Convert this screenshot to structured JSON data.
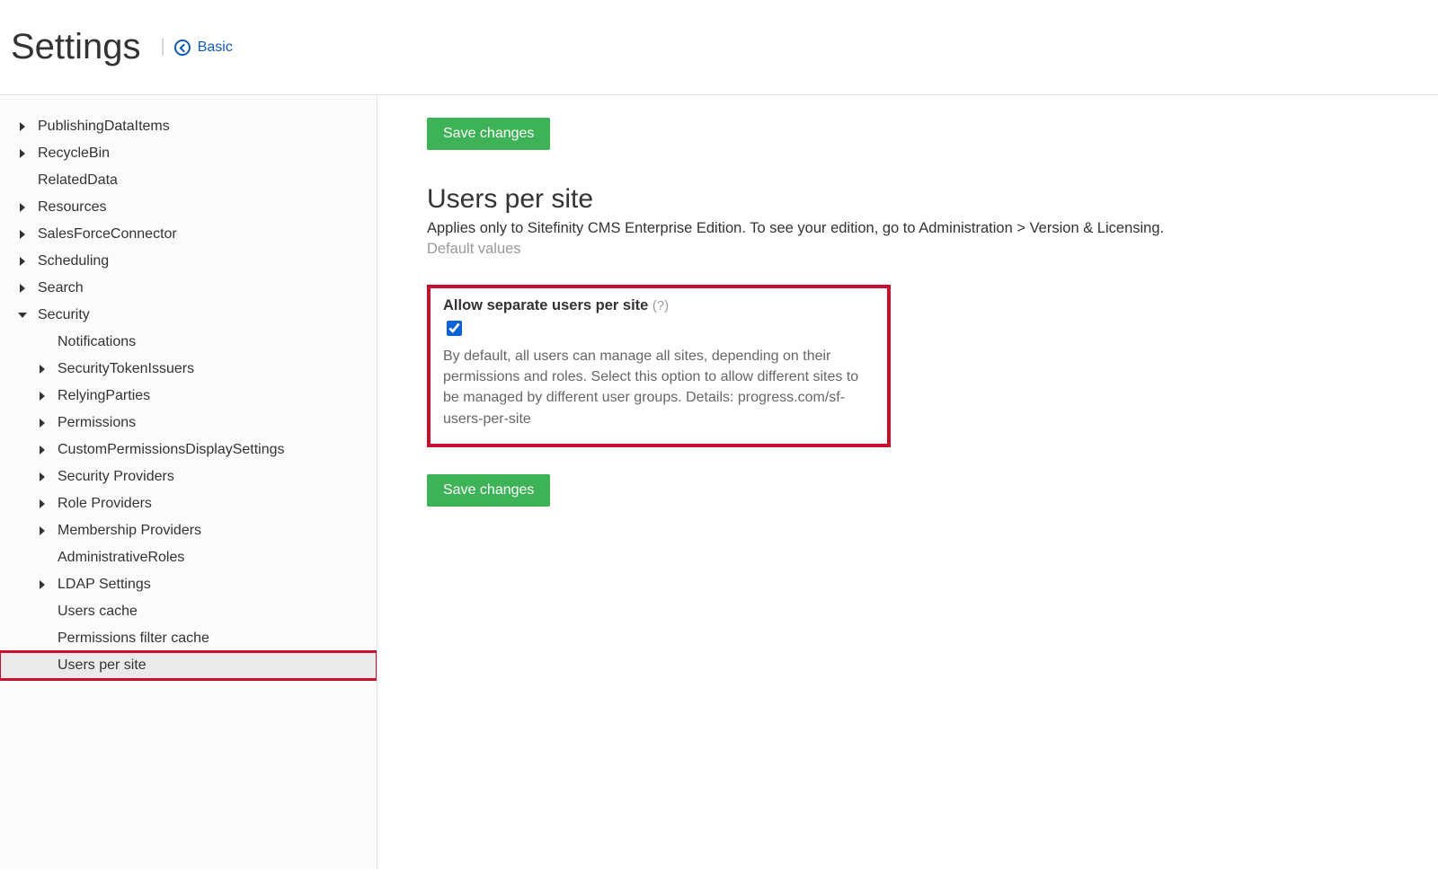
{
  "header": {
    "title": "Settings",
    "basic_link": "Basic"
  },
  "sidebar": {
    "items": [
      {
        "label": "PublishingDataItems",
        "level": 0,
        "caret": "right"
      },
      {
        "label": "RecycleBin",
        "level": 0,
        "caret": "right"
      },
      {
        "label": "RelatedData",
        "level": 0,
        "caret": "none"
      },
      {
        "label": "Resources",
        "level": 0,
        "caret": "right"
      },
      {
        "label": "SalesForceConnector",
        "level": 0,
        "caret": "right"
      },
      {
        "label": "Scheduling",
        "level": 0,
        "caret": "right"
      },
      {
        "label": "Search",
        "level": 0,
        "caret": "right"
      },
      {
        "label": "Security",
        "level": 0,
        "caret": "down"
      },
      {
        "label": "Notifications",
        "level": 1,
        "caret": "none"
      },
      {
        "label": "SecurityTokenIssuers",
        "level": 1,
        "caret": "right"
      },
      {
        "label": "RelyingParties",
        "level": 1,
        "caret": "right"
      },
      {
        "label": "Permissions",
        "level": 1,
        "caret": "right"
      },
      {
        "label": "CustomPermissionsDisplaySettings",
        "level": 1,
        "caret": "right"
      },
      {
        "label": "Security Providers",
        "level": 1,
        "caret": "right"
      },
      {
        "label": "Role Providers",
        "level": 1,
        "caret": "right"
      },
      {
        "label": "Membership Providers",
        "level": 1,
        "caret": "right"
      },
      {
        "label": "AdministrativeRoles",
        "level": 1,
        "caret": "none"
      },
      {
        "label": "LDAP Settings",
        "level": 1,
        "caret": "right"
      },
      {
        "label": "Users cache",
        "level": 1,
        "caret": "none"
      },
      {
        "label": "Permissions filter cache",
        "level": 1,
        "caret": "none"
      },
      {
        "label": "Users per site",
        "level": 1,
        "caret": "none",
        "selected": true,
        "highlight": true
      }
    ]
  },
  "main": {
    "save_label": "Save changes",
    "heading": "Users per site",
    "description": "Applies only to Sitefinity CMS Enterprise Edition. To see your edition, go to Administration > Version & Licensing.",
    "default_values": "Default values",
    "setting": {
      "title": "Allow separate users per site",
      "help": "(?)",
      "checked": true,
      "description": "By default, all users can manage all sites, depending on their permissions and roles. Select this option to allow different sites to be managed by different user groups. Details: progress.com/sf-users-per-site"
    }
  }
}
